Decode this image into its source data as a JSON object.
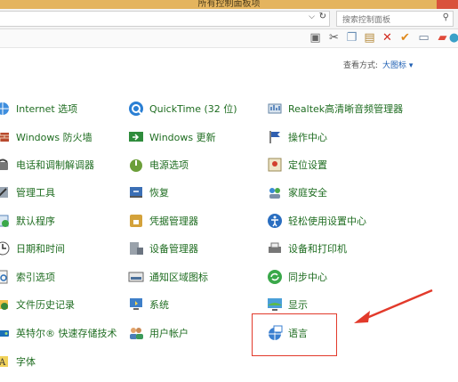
{
  "window": {
    "title": "所有控制面板项"
  },
  "address_bar": {
    "search_placeholder": "搜索控制面板"
  },
  "view": {
    "label": "查看方式:",
    "value": "大图标"
  },
  "columns": [
    [
      {
        "label": "Internet 选项",
        "icon": "globe-icon"
      },
      {
        "label": "Windows 防火墙",
        "icon": "firewall-icon"
      },
      {
        "label": "电话和调制解调器",
        "icon": "phone-icon"
      },
      {
        "label": "管理工具",
        "icon": "admin-tools-icon"
      },
      {
        "label": "默认程序",
        "icon": "default-programs-icon"
      },
      {
        "label": "日期和时间",
        "icon": "clock-icon"
      },
      {
        "label": "索引选项",
        "icon": "index-icon"
      },
      {
        "label": "文件历史记录",
        "icon": "file-history-icon"
      },
      {
        "label": "英特尔® 快速存储技术",
        "icon": "intel-storage-icon"
      },
      {
        "label": "字体",
        "icon": "font-icon"
      }
    ],
    [
      {
        "label": "QuickTime (32 位)",
        "icon": "quicktime-icon"
      },
      {
        "label": "Windows 更新",
        "icon": "windows-update-icon"
      },
      {
        "label": "电源选项",
        "icon": "power-icon"
      },
      {
        "label": "恢复",
        "icon": "recovery-icon"
      },
      {
        "label": "凭据管理器",
        "icon": "credential-icon"
      },
      {
        "label": "设备管理器",
        "icon": "device-manager-icon"
      },
      {
        "label": "通知区域图标",
        "icon": "notification-icon"
      },
      {
        "label": "系统",
        "icon": "system-icon"
      },
      {
        "label": "用户帐户",
        "icon": "user-accounts-icon"
      }
    ],
    [
      {
        "label": "Realtek高清晰音频管理器",
        "icon": "audio-icon"
      },
      {
        "label": "操作中心",
        "icon": "flag-icon"
      },
      {
        "label": "定位设置",
        "icon": "location-icon"
      },
      {
        "label": "家庭安全",
        "icon": "family-safety-icon"
      },
      {
        "label": "轻松使用设置中心",
        "icon": "ease-of-access-icon"
      },
      {
        "label": "设备和打印机",
        "icon": "printer-icon"
      },
      {
        "label": "同步中心",
        "icon": "sync-icon"
      },
      {
        "label": "显示",
        "icon": "display-icon"
      },
      {
        "label": "语言",
        "icon": "language-icon"
      }
    ]
  ],
  "colors": {
    "link_green": "#1f6d21",
    "highlight_red": "#e23a2b",
    "title_bar": "#e4b45e"
  }
}
